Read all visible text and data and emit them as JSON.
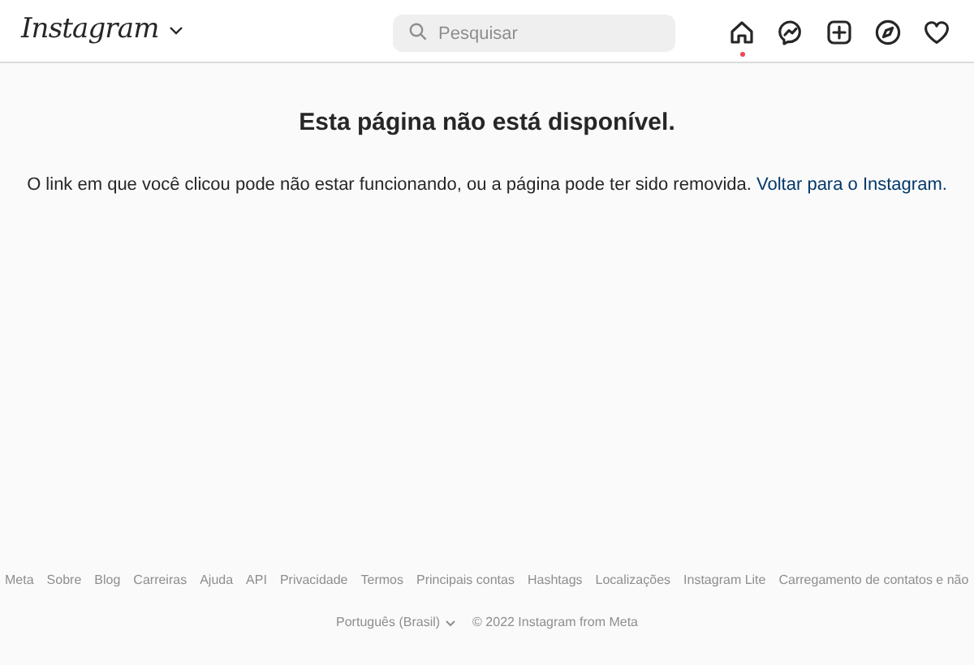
{
  "header": {
    "logo": "Instagram",
    "search": {
      "placeholder": "Pesquisar"
    },
    "nav": [
      {
        "kind": "home",
        "selected": true
      },
      {
        "kind": "messenger",
        "selected": false
      },
      {
        "kind": "create",
        "selected": false
      },
      {
        "kind": "explore",
        "selected": false
      },
      {
        "kind": "activity",
        "selected": false
      }
    ]
  },
  "main": {
    "title": "Esta página não está disponível.",
    "message": "O link em que você clicou pode não estar funcionando, ou a página pode ter sido removida.",
    "link": "Voltar para o Instagram."
  },
  "footer": {
    "links": [
      "Meta",
      "Sobre",
      "Blog",
      "Carreiras",
      "Ajuda",
      "API",
      "Privacidade",
      "Termos",
      "Principais contas",
      "Hashtags",
      "Localizações",
      "Instagram Lite",
      "Carregamento de contatos e não"
    ],
    "language": "Português (Brasil)",
    "copyright": "© 2022 Instagram from Meta"
  }
}
